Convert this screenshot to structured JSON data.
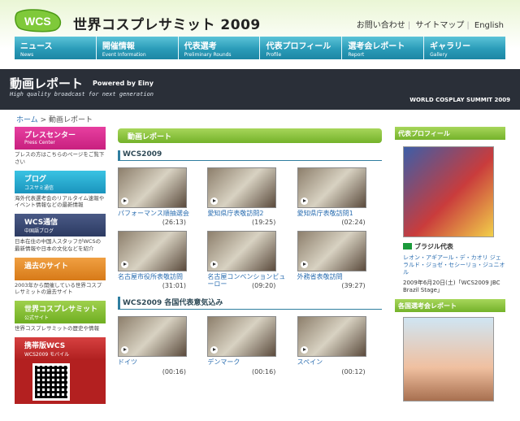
{
  "header": {
    "logo_text": "WCS",
    "title": "世界コスプレサミット 2009",
    "utility_links": [
      "お問い合わせ",
      "サイトマップ",
      "English"
    ]
  },
  "nav": [
    {
      "jp": "ニュース",
      "en": "News"
    },
    {
      "jp": "開催情報",
      "en": "Event Information"
    },
    {
      "jp": "代表選考",
      "en": "Preliminary Rounds"
    },
    {
      "jp": "代表プロフィール",
      "en": "Profile"
    },
    {
      "jp": "選考会レポート",
      "en": "Report"
    },
    {
      "jp": "ギャラリー",
      "en": "Gallery"
    }
  ],
  "banner": {
    "title": "動画レポート",
    "powered": "Powered by Einy",
    "subtitle": "High quality broadcast for next generation",
    "right": "WORLD COSPLAY SUMMIT 2009"
  },
  "breadcrumb": {
    "home": "ホーム",
    "sep": " > ",
    "current": "動画レポート"
  },
  "left": [
    {
      "label": "プレスセンター",
      "en": "Press Center",
      "desc": "プレスの方はこちらのページをご覧下さい",
      "color": "red"
    },
    {
      "label": "ブログ",
      "en": "コスサミ通信",
      "desc": "海外代表選考会のリアルタイム速報やイベント情報などの最新情報",
      "color": "cyan"
    },
    {
      "label": "WCS通信",
      "en": "中国語ブログ",
      "desc": "日本在住の中国人スタッフがWCSの最新情報や日本の文化などを紹介",
      "color": "navy"
    },
    {
      "label": "過去のサイト",
      "en": "",
      "desc": "2003年から開催している世界コスプレサミットの過去サイト",
      "color": "orange"
    },
    {
      "label": "世界コスプレサミット",
      "en": "公式サイト",
      "desc": "世界コスプレサミットの歴史や情報",
      "color": "green"
    }
  ],
  "mobile": {
    "label": "携帯版WCS",
    "sub": "WCS2009 モバイル"
  },
  "main": {
    "section_title": "動画レポート",
    "group1_title": "WCS2009",
    "videos1": [
      {
        "title": "パフォーマンス順抽選会",
        "duration": "(26:13)"
      },
      {
        "title": "愛知県庁表敬訪問2",
        "duration": "(19:25)"
      },
      {
        "title": "愛知県庁表敬訪問1",
        "duration": "(02:24)"
      },
      {
        "title": "名古屋市役所表敬訪問",
        "duration": "(31:01)"
      },
      {
        "title": "名古屋コンベンションビューロー",
        "duration": "(09:20)"
      },
      {
        "title": "外務省表敬訪問",
        "duration": "(39:27)"
      }
    ],
    "group2_title": "WCS2009 各国代表意気込み",
    "videos2": [
      {
        "title": "ドイツ",
        "duration": "(00:16)"
      },
      {
        "title": "デンマーク",
        "duration": "(00:16)"
      },
      {
        "title": "スペイン",
        "duration": "(00:12)"
      }
    ]
  },
  "right": {
    "profile_title": "代表プロフィール",
    "profile_name": "ブラジル代表",
    "profile_desc": "レオン・アギアール・デ・カオリ ジェラルド・ジョゼ・セシーリョ・ジュニオル",
    "profile_note": "2009年6月20日(土)「WCS2009 JBC Brazil Stage」",
    "report_title": "各国選考会レポート"
  },
  "colors": {
    "nav": "#2a9bb8",
    "green": "#74b22a",
    "link": "#2a6db0"
  }
}
